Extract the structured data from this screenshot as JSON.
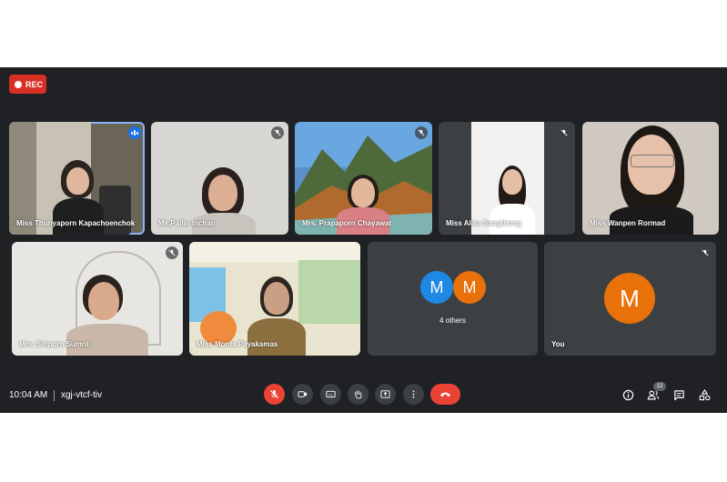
{
  "recording": {
    "label": "REC"
  },
  "participants": {
    "p1": "Miss Thunyaporn Kapachoenchok",
    "p2": "Ms.Pailin Inchan",
    "p3": "Mrs. Prapaporn Chayawat",
    "p4": "Miss Alisa Sangthong",
    "p5": "Miss Wanpen Rormad",
    "p6": "Mrs. Siriporn Sumrit",
    "p7": "Miss Monta Payakamas"
  },
  "others": {
    "count_label": "4 others",
    "avatar1": "M",
    "avatar2": "M"
  },
  "self": {
    "label": "You",
    "avatar": "M"
  },
  "meeting": {
    "time": "10:04 AM",
    "code": "xgj-vtcf-tiv"
  },
  "people_count": "12",
  "colors": {
    "background": "#202124",
    "tile": "#3c4043",
    "danger": "#ea4335",
    "accent": "#1a73e8",
    "avatar_blue": "#1e88e5",
    "avatar_orange": "#e8710a"
  }
}
